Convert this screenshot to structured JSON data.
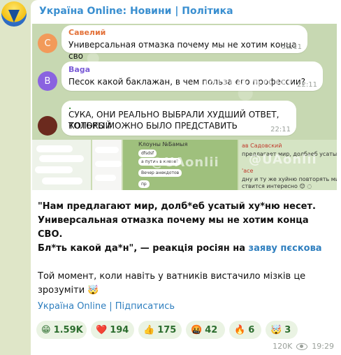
{
  "channel": {
    "title": "Україна Online: Новини | Політика"
  },
  "media_chat": [
    {
      "initial": "С",
      "name": "Савелий",
      "name_color": "#e3723a",
      "avatar_color": "#f29a5a",
      "text": "Универсальная отмазка почему мы не хотим конца сво",
      "time": "22:11"
    },
    {
      "initial": "B",
      "name": "Baga",
      "name_color": "#7a5bd6",
      "avatar_color": "#8a63e0",
      "text": "Песок какой баклажан, в чем польза его профессии?",
      "time": "22:11"
    },
    {
      "initial": "",
      "name": ".",
      "name_color": "#3c8f3c",
      "avatar_color": "#6b2a1e",
      "text_line1": "СУКА, ОНИ РЕАЛЬНО ВЫБРАЛИ ХУДШИЙ ОТВЕТ, КОТОРЫЙ",
      "text_line2": "ТОЛЬКО МОЖНО БЫЛО ПРЕДСТАВИТЬ",
      "time": "22:11"
    }
  ],
  "watermarks": {
    "top1": "@UAonlii",
    "top2": "@UAonlii",
    "strip": "@UAonlii",
    "strip2": "@UAonlii"
  },
  "strip": {
    "t2_name1": "Клоуны №Бамыя",
    "t2_msg1": "dfsdsf",
    "t2_name2": "а путин в киеве?",
    "t2_msg2": "Вечер анекдотов",
    "t2_name3": "пр",
    "t4_name1": "ав Садовский",
    "t4_msg1": "предлагает мир, долбаеб усатый хуй",
    "t4_name2": "'асе",
    "t4_msg2": "дну и ту же хуйню повторять милл",
    "t4_msg3": "ствится интересно 😊 ◌"
  },
  "caption": {
    "bold_line1": "\"Нам предлагают мир, долб*еб усатый ху*ню несет.",
    "bold_line2": "Универсальная отмазка почему мы не хотим конца СВО.",
    "bold_line3": "Бл*ть какой да*н\", — реакція росіян на ",
    "link_text": "заяву пєскова",
    "para2_line1": "Той момент, коли навіть у ватників вистачило мізків це",
    "para2_line2": "зрозуміти 🤯"
  },
  "subscribe_link": "Україна Online | Підписатись",
  "reactions": [
    {
      "emoji": "😁",
      "count": "1.59K"
    },
    {
      "emoji": "❤️",
      "count": "194"
    },
    {
      "emoji": "👍",
      "count": "175"
    },
    {
      "emoji": "🤬",
      "count": "42"
    },
    {
      "emoji": "🔥",
      "count": "6"
    },
    {
      "emoji": "🤯",
      "count": "3"
    }
  ],
  "meta": {
    "views": "120K",
    "time": "19:29"
  },
  "colors": {
    "accent": "#3a8fd0",
    "reaction_bg": "#eaf3e3",
    "reaction_text": "#2c6d2e"
  }
}
